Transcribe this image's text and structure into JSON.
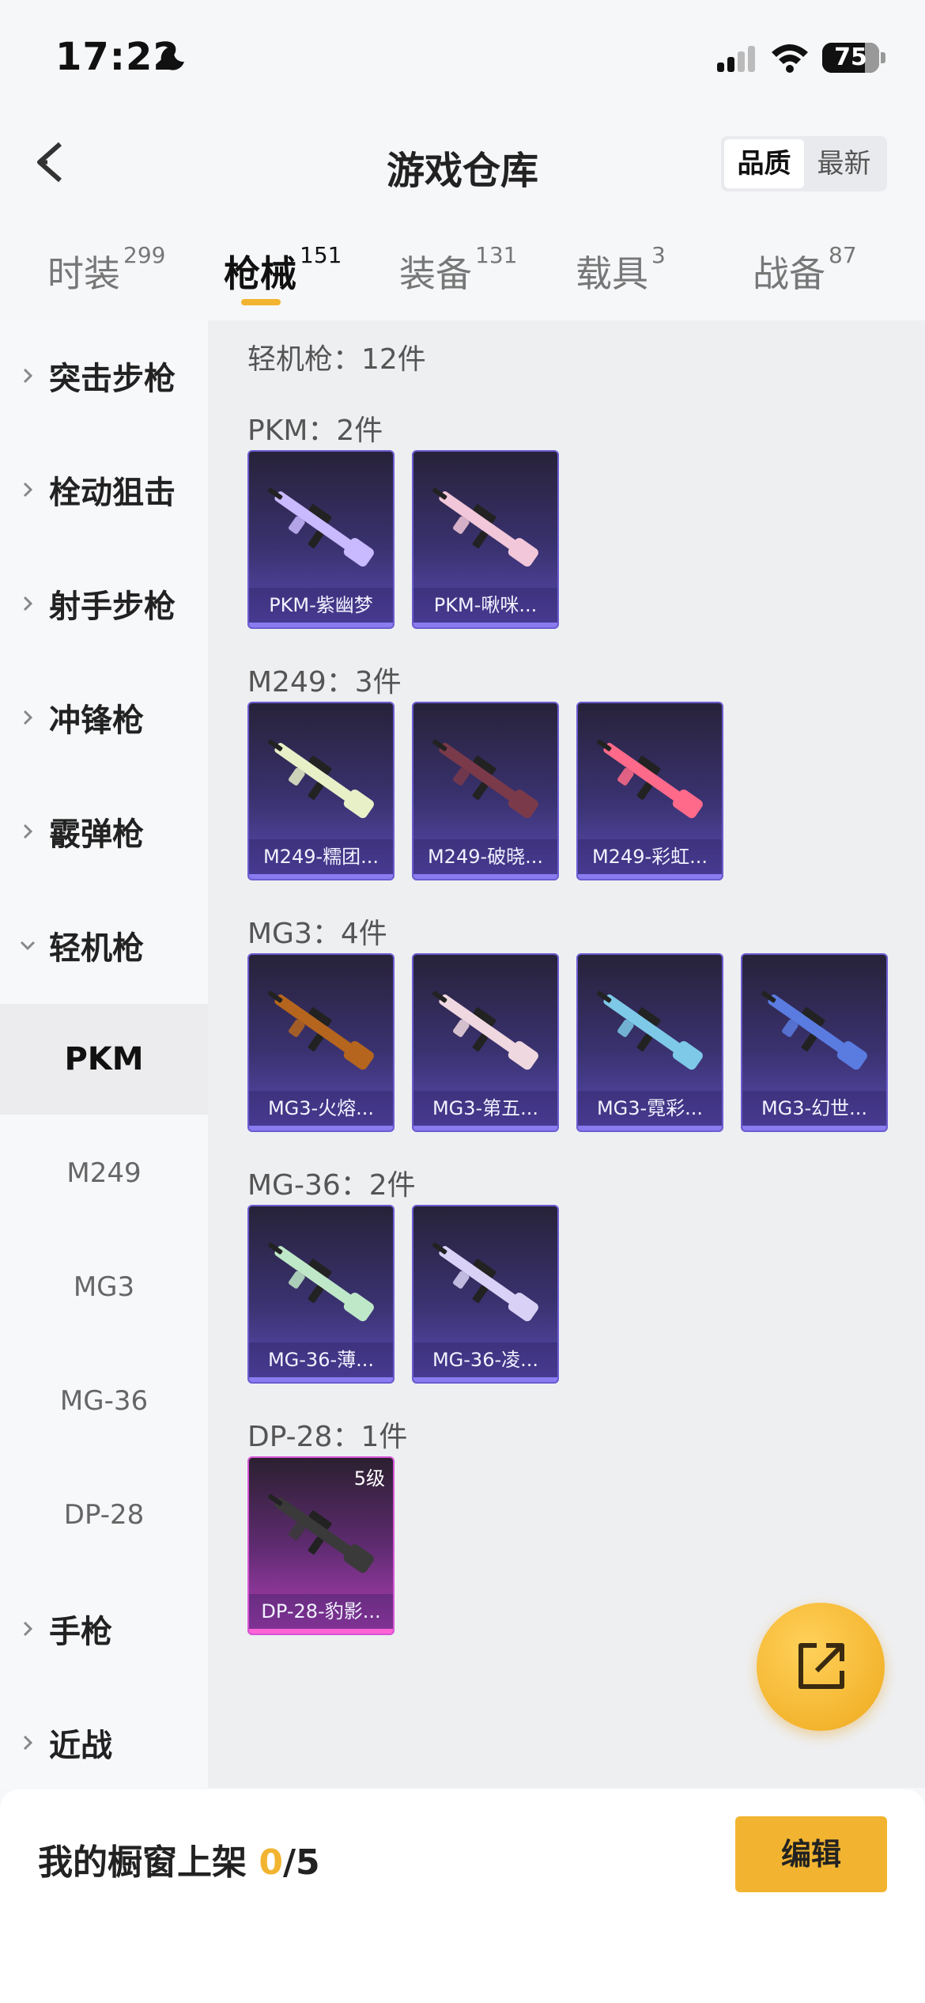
{
  "status_bar": {
    "time": "17:22",
    "battery": "75",
    "battery_level": 0.75
  },
  "header": {
    "title": "游戏仓库",
    "sort_options": [
      "品质",
      "最新"
    ],
    "sort_selected": "品质"
  },
  "tabs": [
    {
      "label": "时装",
      "count": "299"
    },
    {
      "label": "枪械",
      "count": "151"
    },
    {
      "label": "装备",
      "count": "131"
    },
    {
      "label": "载具",
      "count": "3"
    },
    {
      "label": "战备",
      "count": "87"
    }
  ],
  "active_tab": "枪械",
  "sidebar": {
    "categories": [
      {
        "label": "突击步枪"
      },
      {
        "label": "栓动狙击"
      },
      {
        "label": "射手步枪"
      },
      {
        "label": "冲锋枪"
      },
      {
        "label": "霰弹枪"
      },
      {
        "label": "轻机枪"
      }
    ],
    "subitems": [
      "PKM",
      "M249",
      "MG3",
      "MG-36",
      "DP-28"
    ],
    "active_sub": "PKM",
    "more": [
      {
        "label": "手枪"
      },
      {
        "label": "近战"
      }
    ]
  },
  "content": {
    "category_title": "轻机枪：12件",
    "groups": [
      {
        "title": "PKM：2件",
        "items": [
          {
            "name": "PKM-紫幽梦",
            "color": "#c9b9ff"
          },
          {
            "name": "PKM-啾咪...",
            "color": "#f1c7d9"
          }
        ]
      },
      {
        "title": "M249：3件",
        "items": [
          {
            "name": "M249-糯团...",
            "color": "#e8f0c8"
          },
          {
            "name": "M249-破晓...",
            "color": "#7a3a4a"
          },
          {
            "name": "M249-彩虹...",
            "color": "#ff6a8a"
          }
        ]
      },
      {
        "title": "MG3：4件",
        "items": [
          {
            "name": "MG3-火熔...",
            "color": "#b5651d"
          },
          {
            "name": "MG3-第五...",
            "color": "#f0d8e0"
          },
          {
            "name": "MG3-霓彩...",
            "color": "#7ec8e8"
          },
          {
            "name": "MG3-幻世...",
            "color": "#5a7be0"
          }
        ]
      },
      {
        "title": "MG-36：2件",
        "items": [
          {
            "name": "MG-36-薄...",
            "color": "#bfe8c8"
          },
          {
            "name": "MG-36-凌...",
            "color": "#d9d2f6"
          }
        ]
      },
      {
        "title": "DP-28：1件",
        "items": [
          {
            "name": "DP-28-豹影...",
            "color": "#3a3a3a",
            "level": "5级",
            "pink": true
          }
        ]
      }
    ]
  },
  "bottom": {
    "showcase_label": "我的橱窗上架 ",
    "showcase_current": "0",
    "showcase_total": "/5",
    "edit_label": "编辑"
  },
  "colors": {
    "accent": "#f2b430",
    "card_purple": "#5a4bb3",
    "card_pink": "#b23fb8"
  }
}
